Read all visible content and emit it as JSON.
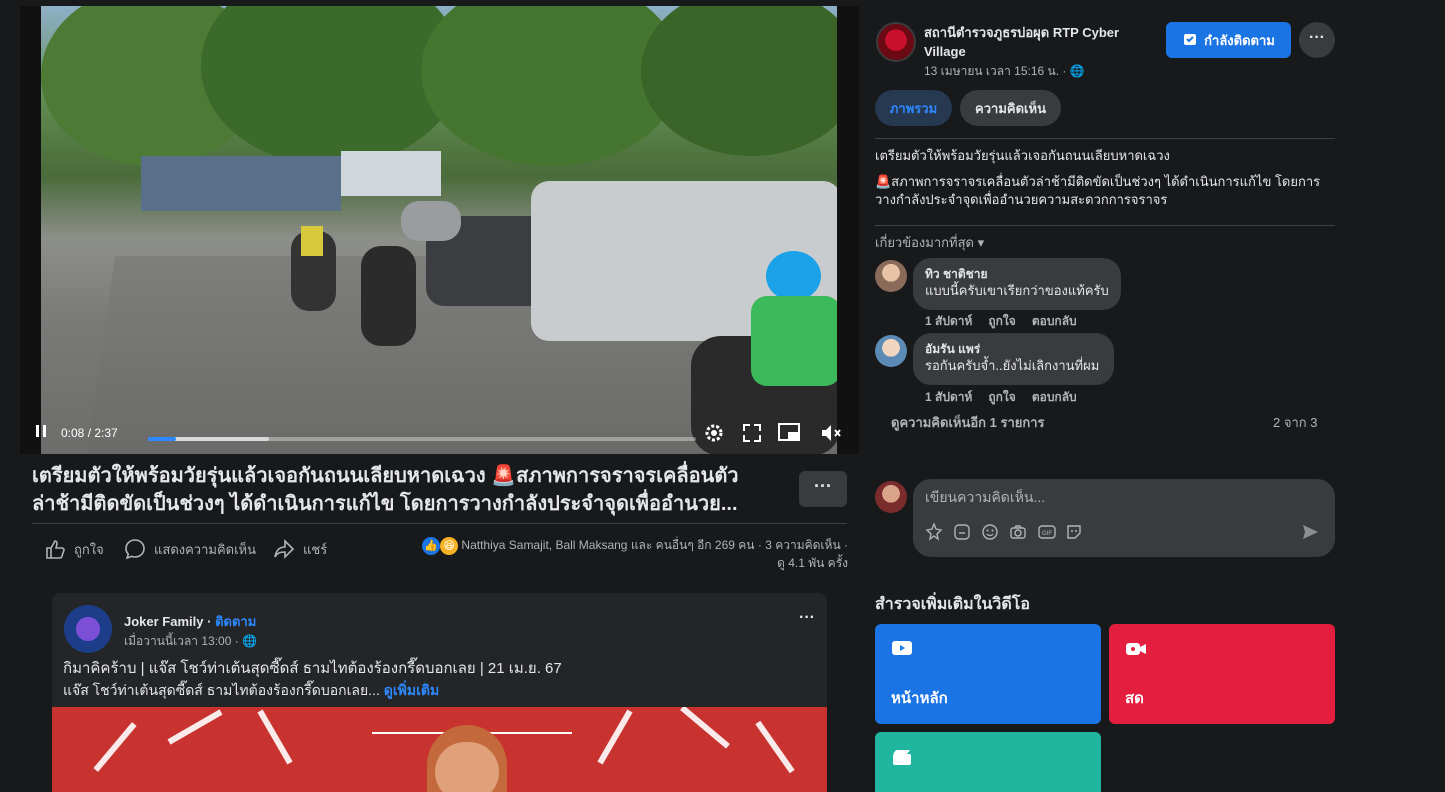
{
  "video": {
    "time": "0:08 / 2:37",
    "progress_fraction": 0.051,
    "buffered_fraction": 0.22
  },
  "post": {
    "title_line1": "เตรียมตัวให้พร้อมวัยรุ่นแล้วเจอกันถนนเลียบหาดเฉวง 🚨สภาพการจราจรเคลื่อนตัว",
    "title_line2": "ล่าช้ามีติดขัดเป็นช่วงๆ ได้ดำเนินการแก้ไข โดยการวางกำลังประจำจุดเพื่ออำนวย...",
    "more_label": "···",
    "like_label": "ถูกใจ",
    "comment_label": "แสดงความคิดเห็น",
    "share_label": "แชร์",
    "reactions_text": "Natthiya Samajit, Ball Maksang และ คนอื่นๆ อีก 269 คน",
    "comment_count": "3 ความคิดเห็น",
    "views": "ดู 4.1 พัน ครั้ง",
    "sep": "·"
  },
  "page": {
    "name": "สถานีตำรวจภูธรบ่อผุด RTP Cyber Village",
    "time": "13 เมษายน เวลา 15:16 น. ·",
    "follow_label": "กำลังติดตาม",
    "more_label": "···"
  },
  "tabs": {
    "overview": "ภาพรวม",
    "comments": "ความคิดเห็น"
  },
  "description": {
    "line1": "เตรียมตัวให้พร้อมวัยรุ่นแล้วเจอกันถนนเลียบหาดเฉวง",
    "line2": "🚨สภาพการจราจรเคลื่อนตัวล่าช้ามีติดขัดเป็นช่วงๆ ได้ดำเนินการแก้ไข โดยการวางกำลังประจำจุดเพื่ออำนวยความสะดวกการจราจร"
  },
  "comments": {
    "sort_label": "เกี่ยวข้องมากที่สุด",
    "items": [
      {
        "author": "ทิว ชาติชาย",
        "text": "แบบนี้ครับเขาเรียกว่าของแท้ครับ",
        "time": "1 สัปดาห์",
        "like": "ถูกใจ",
        "reply": "ตอบกลับ"
      },
      {
        "author": "อัมรัน แพร่",
        "text": "รอกันครับจ้ำ..ยังไม่เลิกงานที่ผม",
        "time": "1 สัปดาห์",
        "like": "ถูกใจ",
        "reply": "ตอบกลับ"
      }
    ],
    "more_label": "ดูความคิดเห็นอีก 1 รายการ",
    "count_label": "2 จาก 3",
    "input_placeholder": "เขียนความคิดเห็น..."
  },
  "feed_post": {
    "author": "Joker Family",
    "follow": "ติดตาม",
    "sep": "·",
    "time": "เมื่อวานนี้เวลา 13:00 ·",
    "more": "···",
    "title": "กิมาคิคร้าบ | แจ๊ส โชว์ท่าเต้นสุดซี๊ดส์ ธามไทต้องร้องกรี๊ดบอกเลย | 21 เม.ย. 67",
    "subtitle": "แจ๊ส โชว์ท่าเต้นสุดซี๊ดส์ ธามไทต้องร้องกรี๊ดบอกเลย...",
    "see_more": "ดูเพิ่มเติม"
  },
  "explore": {
    "title": "สำรวจเพิ่มเติมในวิดีโอ",
    "tiles": [
      {
        "label": "หน้าหลัก",
        "color": "#1b74e4",
        "icon": "play-icon"
      },
      {
        "label": "สด",
        "color": "#e41e3f",
        "icon": "live-icon"
      },
      {
        "label": "",
        "color": "#20b59f",
        "icon": "clapper-icon"
      }
    ]
  }
}
